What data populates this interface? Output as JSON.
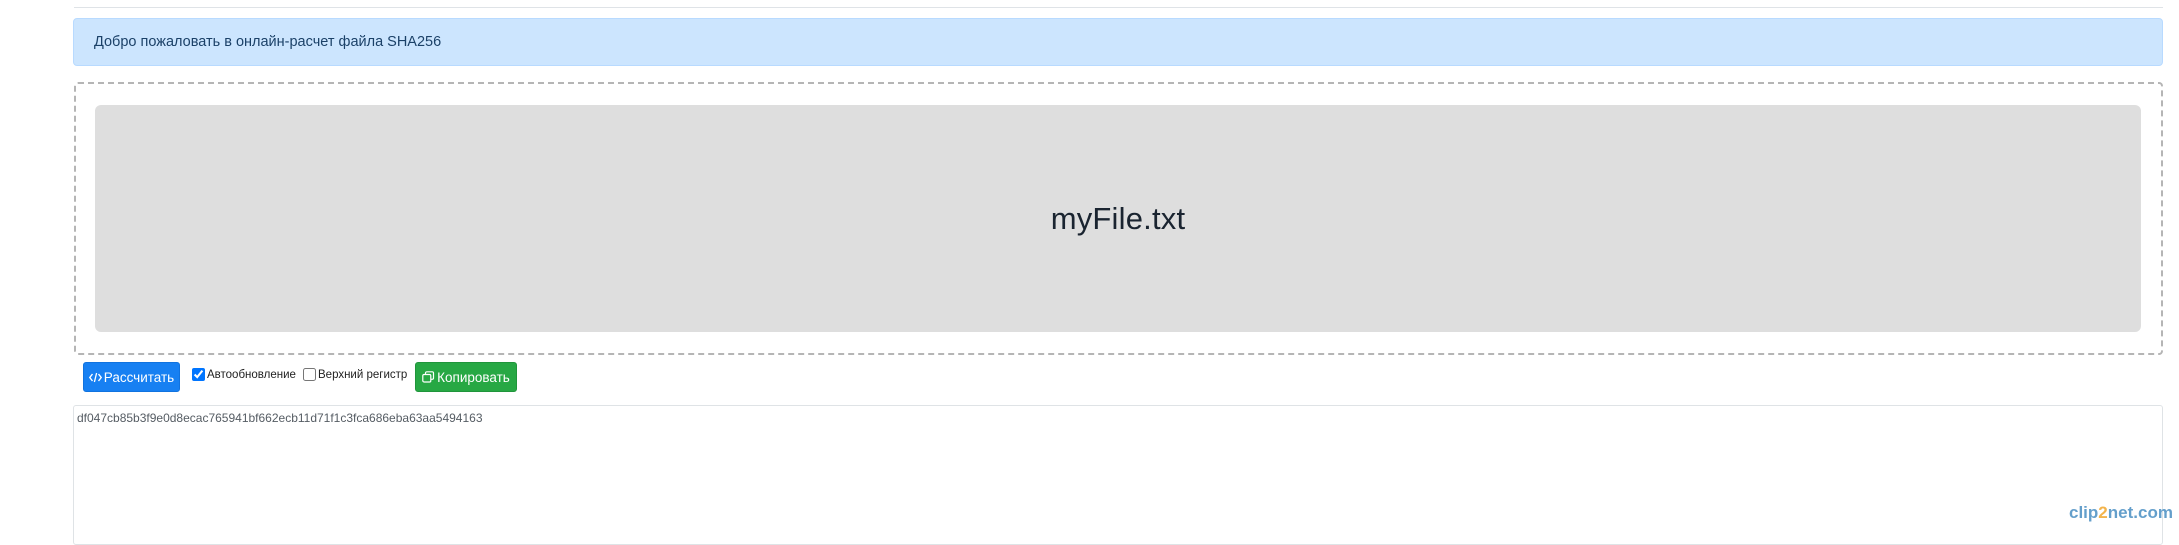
{
  "alert": {
    "text": "Добро пожаловать в онлайн-расчет файла SHA256"
  },
  "drop_zone": {
    "file_name": "myFile.txt"
  },
  "toolbar": {
    "calculate_label": "Рассчитать",
    "calculate_icon": "code-icon",
    "auto_update_label": "Автообновление",
    "auto_update_checked": true,
    "uppercase_label": "Верхний регистр",
    "uppercase_checked": false,
    "copy_label": "Копировать",
    "copy_icon": "copy-icon"
  },
  "output": {
    "hash": "df047cb85b3f9e0d8ecac765941bf662ecb11d71f1c3fca686eba63aa5494163"
  },
  "watermark": {
    "text_pre": "clip",
    "text_num": "2",
    "text_post": "net.com"
  },
  "colors": {
    "alert_bg": "#cce5fe",
    "primary": "#1780f2",
    "success": "#27a844",
    "drop_bg": "#dedede"
  }
}
